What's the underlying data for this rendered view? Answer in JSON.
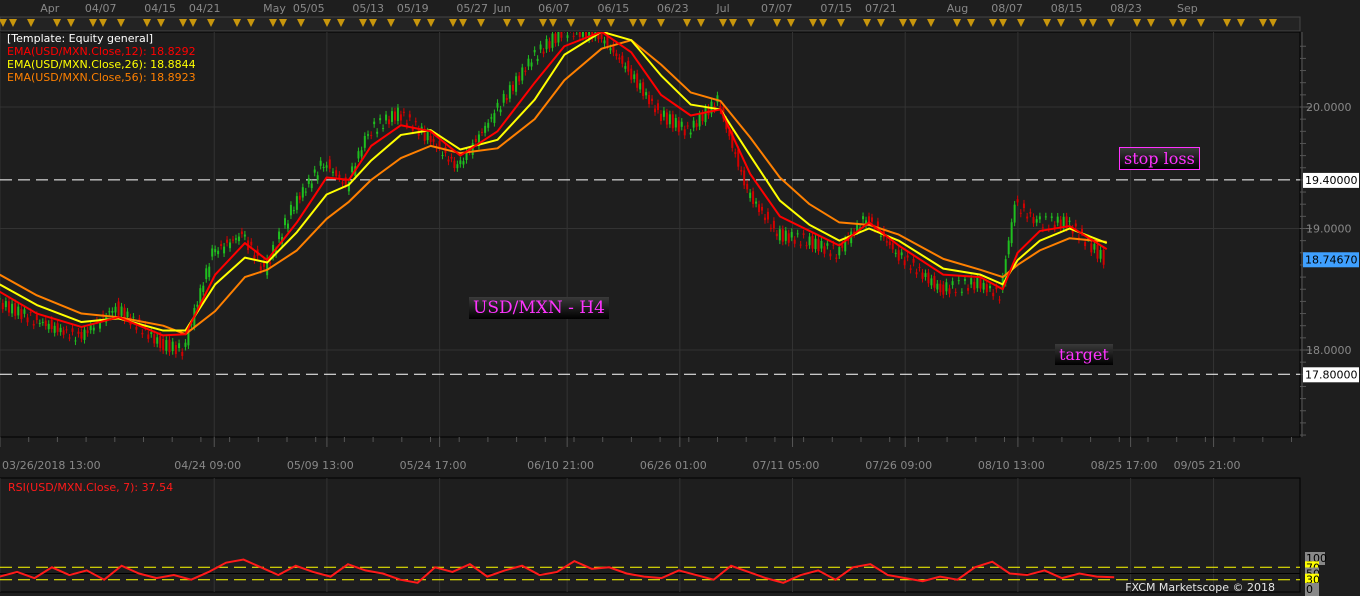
{
  "top_axis_labels": [
    {
      "label": "Apr",
      "date": "2018-04-01"
    },
    {
      "label": "04/07",
      "date": "2018-04-07"
    },
    {
      "label": "04/15",
      "date": "2018-04-15"
    },
    {
      "label": "04/21",
      "date": "2018-04-21"
    },
    {
      "label": "May",
      "date": "2018-05-01"
    },
    {
      "label": "05/05",
      "date": "2018-05-05"
    },
    {
      "label": "05/13",
      "date": "2018-05-13"
    },
    {
      "label": "05/19",
      "date": "2018-05-19"
    },
    {
      "label": "05/27",
      "date": "2018-05-27"
    },
    {
      "label": "Jun",
      "date": "2018-06-01"
    },
    {
      "label": "06/07",
      "date": "2018-06-07"
    },
    {
      "label": "06/15",
      "date": "2018-06-15"
    },
    {
      "label": "06/23",
      "date": "2018-06-23"
    },
    {
      "label": "Jul",
      "date": "2018-07-01"
    },
    {
      "label": "07/07",
      "date": "2018-07-07"
    },
    {
      "label": "07/15",
      "date": "2018-07-15"
    },
    {
      "label": "07/21",
      "date": "2018-07-21"
    },
    {
      "label": "Aug",
      "date": "2018-08-01"
    },
    {
      "label": "08/07",
      "date": "2018-08-07"
    },
    {
      "label": "08/15",
      "date": "2018-08-15"
    },
    {
      "label": "08/23",
      "date": "2018-08-23"
    },
    {
      "label": "Sep",
      "date": "2018-09-01"
    }
  ],
  "bottom_axis_labels": [
    {
      "label": "03/26/2018 13:00",
      "date": "2018-03-26T13:00"
    },
    {
      "label": "04/24 09:00",
      "date": "2018-04-24T09:00"
    },
    {
      "label": "05/09 13:00",
      "date": "2018-05-09T13:00"
    },
    {
      "label": "05/24 17:00",
      "date": "2018-05-24T17:00"
    },
    {
      "label": "06/10 21:00",
      "date": "2018-06-10T21:00"
    },
    {
      "label": "06/26 01:00",
      "date": "2018-06-26T01:00"
    },
    {
      "label": "07/11 05:00",
      "date": "2018-07-11T05:00"
    },
    {
      "label": "07/26 09:00",
      "date": "2018-07-26T09:00"
    },
    {
      "label": "08/10 13:00",
      "date": "2018-08-10T13:00"
    },
    {
      "label": "08/25 17:00",
      "date": "2018-08-25T17:00"
    },
    {
      "label": "09/05 21:00",
      "date": "2018-09-05T21:00"
    }
  ],
  "legend": {
    "template": "[Template: Equity general]",
    "ema12": "EMA(USD/MXN.Close,12): 18.8292",
    "ema26": "EMA(USD/MXN.Close,26): 18.8844",
    "ema56": "EMA(USD/MXN.Close,56): 18.8923"
  },
  "annotations": {
    "title": "USD/MXN - H4",
    "stop_loss": "stop loss",
    "target": "target"
  },
  "rsi_label": "RSI(USD/MXN.Close, 7): 37.54",
  "credit": "FXCM Marketscope © 2018",
  "colors": {
    "background": "#1e1e1e",
    "grid": "#333333",
    "up": "#1fbf1f",
    "down": "#d40000",
    "ema12": "#ff0000",
    "ema26": "#ffff00",
    "ema56": "#ff8000",
    "current_price": "#3fa0ff",
    "annotation": "#ff33ff",
    "rsi": "#ff1a1a",
    "rsi_levels": "#ffff00"
  },
  "chart_data": [
    {
      "type": "line",
      "title": "USD/MXN - H4",
      "ylim": [
        17.28,
        20.62
      ],
      "y_ticks": [
        "20.0000",
        "19.0000",
        "18.0000"
      ],
      "horizontal_lines": [
        {
          "label": "19.40000",
          "value": 19.4,
          "style": "dashed",
          "name": "stop loss"
        },
        {
          "label": "17.80000",
          "value": 17.8,
          "style": "dashed",
          "name": "target"
        }
      ],
      "current_price": {
        "label": "18.74670",
        "value": 18.7467
      },
      "x": [
        "2018-03-26",
        "2018-03-31",
        "2018-04-06",
        "2018-04-11",
        "2018-04-17",
        "2018-04-20",
        "2018-04-24",
        "2018-04-28",
        "2018-05-01",
        "2018-05-05",
        "2018-05-09",
        "2018-05-12",
        "2018-05-15",
        "2018-05-19",
        "2018-05-23",
        "2018-05-27",
        "2018-06-01",
        "2018-06-06",
        "2018-06-10",
        "2018-06-15",
        "2018-06-19",
        "2018-06-23",
        "2018-06-27",
        "2018-07-01",
        "2018-07-05",
        "2018-07-09",
        "2018-07-13",
        "2018-07-17",
        "2018-07-21",
        "2018-07-25",
        "2018-07-31",
        "2018-08-05",
        "2018-08-08",
        "2018-08-10",
        "2018-08-13",
        "2018-08-17",
        "2018-08-22"
      ],
      "series": [
        {
          "name": "EMA(USD/MXN.Close,12)",
          "color": "#ff0000",
          "values": [
            18.48,
            18.3,
            18.19,
            18.27,
            18.12,
            18.13,
            18.62,
            18.88,
            18.74,
            19.05,
            19.42,
            19.4,
            19.68,
            19.85,
            19.8,
            19.6,
            19.8,
            20.2,
            20.5,
            20.62,
            20.45,
            20.1,
            19.93,
            19.98,
            19.45,
            19.1,
            18.98,
            18.86,
            19.05,
            18.86,
            18.62,
            18.6,
            18.5,
            18.8,
            18.98,
            19.02,
            18.83
          ]
        },
        {
          "name": "EMA(USD/MXN.Close,26)",
          "color": "#ffff00",
          "values": [
            18.54,
            18.37,
            18.23,
            18.26,
            18.16,
            18.16,
            18.54,
            18.76,
            18.72,
            18.97,
            19.28,
            19.36,
            19.56,
            19.77,
            19.81,
            19.65,
            19.73,
            20.06,
            20.43,
            20.62,
            20.55,
            20.26,
            20.02,
            19.98,
            19.6,
            19.23,
            19.03,
            18.9,
            19.0,
            18.9,
            18.67,
            18.62,
            18.54,
            18.74,
            18.9,
            19.0,
            18.88
          ]
        },
        {
          "name": "EMA(USD/MXN.Close,56)",
          "color": "#ff8000",
          "values": [
            18.62,
            18.45,
            18.3,
            18.27,
            18.2,
            18.13,
            18.32,
            18.6,
            18.66,
            18.82,
            19.08,
            19.22,
            19.4,
            19.58,
            19.68,
            19.62,
            19.66,
            19.9,
            20.22,
            20.48,
            20.55,
            20.35,
            20.12,
            20.05,
            19.75,
            19.42,
            19.2,
            19.05,
            19.03,
            18.95,
            18.75,
            18.66,
            18.6,
            18.7,
            18.82,
            18.92,
            18.89
          ]
        },
        {
          "name": "USD/MXN.Close",
          "values": [
            18.4,
            18.25,
            18.1,
            18.35,
            18.05,
            18.0,
            18.8,
            18.95,
            18.65,
            19.2,
            19.55,
            19.35,
            19.8,
            19.95,
            19.75,
            19.5,
            19.95,
            20.4,
            20.62,
            20.6,
            20.3,
            19.95,
            19.8,
            20.05,
            19.3,
            18.95,
            18.9,
            18.8,
            19.1,
            18.8,
            18.5,
            18.55,
            18.45,
            19.2,
            19.05,
            19.05,
            18.75
          ]
        }
      ]
    },
    {
      "type": "line",
      "title": "RSI(USD/MXN.Close, 7): 37.54",
      "ylim": [
        0,
        100
      ],
      "y_ticks": [
        "100",
        "70",
        "50",
        "30",
        "0"
      ],
      "levels": [
        70,
        30
      ],
      "x_range": [
        "2018-03-26",
        "2018-08-23"
      ],
      "values": [
        40,
        55,
        35,
        70,
        45,
        60,
        30,
        75,
        50,
        35,
        45,
        30,
        55,
        85,
        95,
        70,
        45,
        75,
        55,
        40,
        80,
        60,
        50,
        30,
        20,
        70,
        55,
        80,
        40,
        60,
        75,
        45,
        55,
        90,
        65,
        70,
        50,
        40,
        35,
        60,
        45,
        30,
        75,
        55,
        35,
        20,
        45,
        60,
        30,
        70,
        80,
        45,
        35,
        25,
        40,
        30,
        70,
        88,
        50,
        45,
        60,
        35,
        50,
        40,
        38
      ]
    }
  ]
}
